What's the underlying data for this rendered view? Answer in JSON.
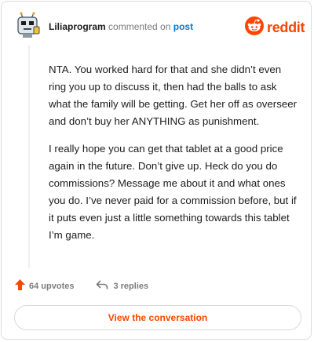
{
  "header": {
    "username": "Liliaprogram",
    "action_text": " commented on ",
    "post_link": "post"
  },
  "brand": {
    "icon": "reddit-snoo-icon",
    "wordmark": "reddit",
    "color": "#ff4500"
  },
  "comment": {
    "paragraphs": [
      "NTA. You worked hard for that and she didn’t even ring you up to discuss it, then had the balls to ask what the family will be getting. Get her off as overseer and don’t buy her ANYTHING as punishment.",
      "I really hope you can get that tablet at a good price again in the future. Don’t give up. Heck do you do commissions? Message me about it and what ones you do. I’ve never paid for a commission before, but if it puts even just a little something towards this tablet I’m game."
    ]
  },
  "stats": {
    "upvotes_label": "64 upvotes",
    "replies_label": "3 replies",
    "upvote_icon": "upvote-arrow-icon",
    "reply_icon": "reply-arrow-icon"
  },
  "cta": {
    "label": "View the conversation"
  },
  "colors": {
    "accent": "#ff4500",
    "link": "#0079d3",
    "text": "#1c1c1c",
    "muted": "#7c7c7c",
    "border": "#d7dadc"
  }
}
